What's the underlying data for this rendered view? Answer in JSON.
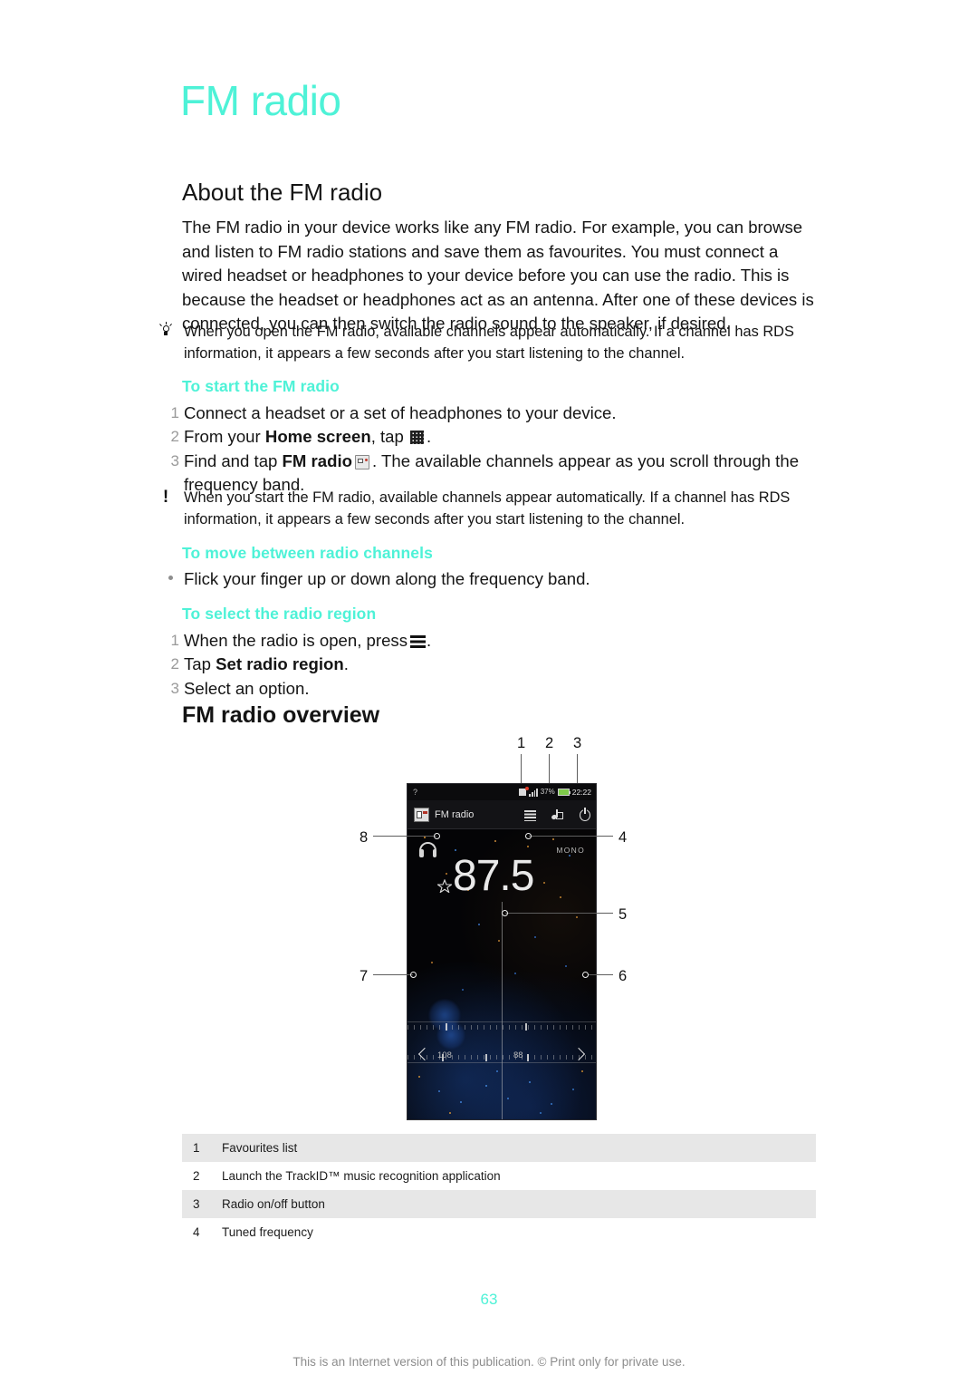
{
  "chapter": {
    "title": "FM radio"
  },
  "about": {
    "heading": "About the FM radio",
    "paragraph": "The FM radio in your device works like any FM radio. For example, you can browse and listen to FM radio stations and save them as favourites. You must connect a wired headset or headphones to your device before you can use the radio. This is because the headset or headphones act as an antenna. After one of these devices is connected, you can then switch the radio sound to the speaker, if desired.",
    "tip": "When you open the FM radio, available channels appear automatically. If a channel has RDS information, it appears a few seconds after you start listening to the channel."
  },
  "start_section": {
    "heading": "To start the FM radio",
    "step1": "Connect a headset or a set of headphones to your device.",
    "step2_pre": "From your ",
    "step2_bold": "Home screen",
    "step2_post": ", tap",
    "step2_end": ".",
    "step3_pre": "Find and tap ",
    "step3_bold": "FM radio",
    "step3_post": ". The available channels appear as you scroll through the frequency band.",
    "note": "When you start the FM radio, available channels appear automatically. If a channel has RDS information, it appears a few seconds after you start listening to the channel."
  },
  "move_section": {
    "heading": "To move between radio channels",
    "bullet": "Flick your finger up or down along the frequency band."
  },
  "region_section": {
    "heading": "To select the radio region",
    "step1_pre": "When the radio is open, press",
    "step1_post": ".",
    "step2_pre": "Tap ",
    "step2_bold": "Set radio region",
    "step2_post": ".",
    "step3": "Select an option."
  },
  "overview": {
    "heading": "FM radio overview",
    "callouts": [
      "1",
      "2",
      "3",
      "4",
      "5",
      "6",
      "7",
      "8"
    ],
    "phone": {
      "statusbar": {
        "left_glyph": "?",
        "signal_pct": "37%",
        "time": "22:22"
      },
      "app_title": "FM radio",
      "buttons": {
        "favourites": "favourites-list",
        "trackid": "trackid",
        "power": "radio-on-off"
      },
      "mono_label": "MONO",
      "frequency": "87.5",
      "band_high": "108",
      "band_low": "88"
    }
  },
  "legend": {
    "rows": [
      {
        "num": "1",
        "text": "Favourites list"
      },
      {
        "num": "2",
        "text": "Launch the TrackID™ music recognition application"
      },
      {
        "num": "3",
        "text": "Radio on/off button"
      },
      {
        "num": "4",
        "text": "Tuned frequency"
      }
    ]
  },
  "footer": {
    "page_number": "63",
    "notice": "This is an Internet version of this publication. © Print only for private use."
  },
  "colors": {
    "accent": "#4ef2d7",
    "text": "#151515",
    "muted": "#8d8d8d",
    "row_shade": "#e7e7e7"
  }
}
